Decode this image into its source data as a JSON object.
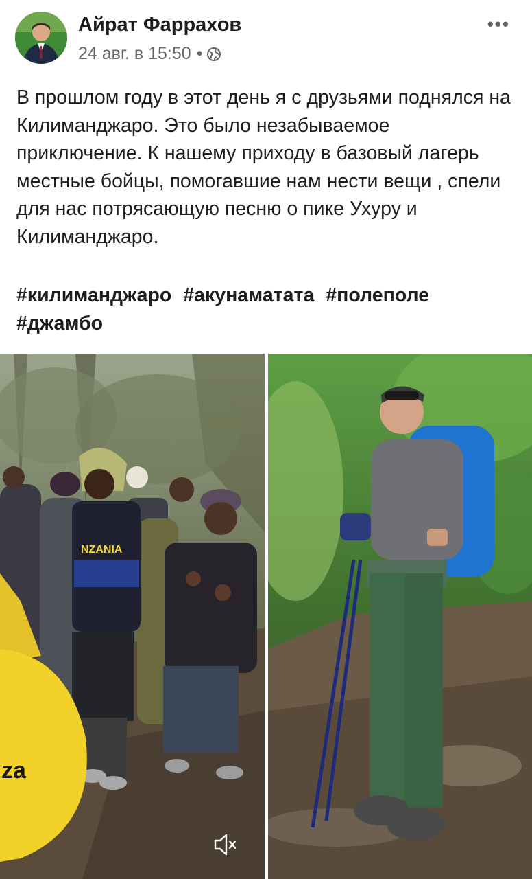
{
  "post": {
    "author": "Айрат Фаррахов",
    "timestamp": "24 авг. в 15:50",
    "separator": "•",
    "privacy_icon": "globe-icon",
    "more_label": "•••",
    "text": "В прошлом году в этот день я с друзьями поднялся на Килиманджаро. Это было незабываемое приключение. К нашему приходу в базовый лагерь местные бойцы, помогавшие нам нести вещи , спели для нас потрясающую песню о пике Ухуру и Килиманджаро.",
    "hashtags": [
      "#килиманджаро",
      "#акунаматата",
      "#полеполе",
      "#джамбо"
    ]
  },
  "media": {
    "left_photo_shirt_text": "NZANIA",
    "left_photo_bag_text": "za",
    "mute_icon": "speaker-muted-icon"
  },
  "colors": {
    "text": "#1c1e21",
    "secondary": "#65676b"
  }
}
